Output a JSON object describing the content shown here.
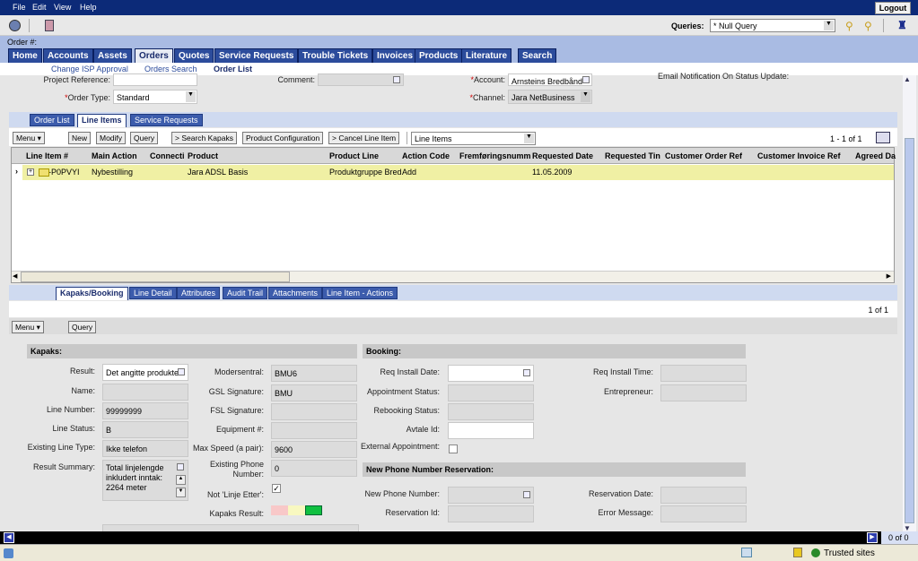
{
  "menu": [
    "File",
    "Edit",
    "View",
    "Help"
  ],
  "logout": "Logout",
  "queries": {
    "label": "Queries:",
    "value": "* Null Query"
  },
  "order_number_label": "Order #:",
  "main_tabs": [
    "Home",
    "Accounts",
    "Assets",
    "Orders",
    "Quotes",
    "Service Requests",
    "Trouble Tickets",
    "Invoices",
    "Products",
    "Literature",
    "Search"
  ],
  "sub_tabs": [
    "Change ISP Approval",
    "Orders Search",
    "Order List"
  ],
  "order_form": {
    "project_reference": {
      "label": "Project Reference:",
      "value": ""
    },
    "order_type": {
      "label": "Order Type:",
      "value": "Standard"
    },
    "comment": {
      "label": "Comment:",
      "value": ""
    },
    "account": {
      "label": "Account:",
      "value": "Arnsteins Bredbånd"
    },
    "channel": {
      "label": "Channel:",
      "value": "Jara NetBusiness"
    },
    "email_notification": {
      "label": "Email Notification On Status Update:"
    }
  },
  "view_tabs": [
    "Order List",
    "Line Items",
    "Service Requests"
  ],
  "line_toolbar": {
    "menu": "Menu ▾",
    "buttons": [
      "New",
      "Modify",
      "Query",
      "> Search Kapaks",
      "Product Configuration",
      "> Cancel Line Item"
    ],
    "view_select": "Line Items",
    "count": "1 - 1 of 1"
  },
  "grid": {
    "columns": [
      "Line Item #",
      "Main Action",
      "Connecti",
      "Product",
      "Product Line",
      "Action Code",
      "Fremføringsnumm",
      "Requested Date",
      "Requested Tin",
      "Customer Order Ref",
      "Customer Invoice Ref",
      "Agreed Da"
    ],
    "rows": [
      [
        "1-P0PVYI",
        "Nybestilling",
        "",
        "Jara ADSL Basis",
        "Produktgruppe Bred",
        "Add",
        "",
        "11.05.2009",
        "",
        "",
        "",
        ""
      ]
    ]
  },
  "detail_tabs": [
    "Kapaks/Booking",
    "Line Detail",
    "Attributes",
    "Audit Trail",
    "Attachments",
    "Line Item - Actions"
  ],
  "detail_count": "1 of 1",
  "detail_toolbar": {
    "menu": "Menu ▾",
    "query": "Query"
  },
  "kapaks": {
    "title": "Kapaks:",
    "result": {
      "label": "Result:",
      "value": "Det angitte produktet"
    },
    "name": {
      "label": "Name:",
      "value": ""
    },
    "line_number": {
      "label": "Line Number:",
      "value": "99999999"
    },
    "line_status": {
      "label": "Line Status:",
      "value": "B"
    },
    "existing_line_type": {
      "label": "Existing Line Type:",
      "value": "Ikke telefon"
    },
    "result_summary": {
      "label": "Result Summary:",
      "value": "Total linjelengde inkludert inntak: 2264 meter"
    },
    "modersentral": {
      "label": "Modersentral:",
      "value": "BMU6"
    },
    "gsl_signature": {
      "label": "GSL Signature:",
      "value": "BMU"
    },
    "fsl_signature": {
      "label": "FSL Signature:",
      "value": ""
    },
    "equipment": {
      "label": "Equipment #:",
      "value": ""
    },
    "max_speed": {
      "label": "Max Speed (a pair):",
      "value": "9600"
    },
    "existing_phone": {
      "label": "Existing Phone Number:",
      "value": "0"
    },
    "not_linje_etter": {
      "label": "Not 'Linje Etter':",
      "checked": true
    },
    "kapaks_result": {
      "label": "Kapaks Result:",
      "colors": [
        "#f8c8c8",
        "#f8f8c0",
        "#10c040"
      ],
      "active": "green"
    }
  },
  "booking": {
    "title": "Booking:",
    "req_install_date": {
      "label": "Req Install Date:",
      "value": ""
    },
    "appointment_status": {
      "label": "Appointment Status:",
      "value": ""
    },
    "rebooking_status": {
      "label": "Rebooking Status:",
      "value": ""
    },
    "avtale_id": {
      "label": "Avtale Id:",
      "value": ""
    },
    "external_appointment": {
      "label": "External Appointment:",
      "checked": false
    },
    "req_install_time": {
      "label": "Req Install Time:",
      "value": ""
    },
    "entrepreneur": {
      "label": "Entrepreneur:",
      "value": ""
    }
  },
  "reservation": {
    "title": "New Phone Number Reservation:",
    "new_phone_number": {
      "label": "New Phone Number:",
      "value": ""
    },
    "reservation_id": {
      "label": "Reservation Id:",
      "value": ""
    },
    "reservation_date": {
      "label": "Reservation Date:",
      "value": ""
    },
    "error_message": {
      "label": "Error Message:",
      "value": ""
    }
  },
  "bottom_pager": "0 of 0",
  "status_bar": {
    "zone": "Trusted sites"
  }
}
